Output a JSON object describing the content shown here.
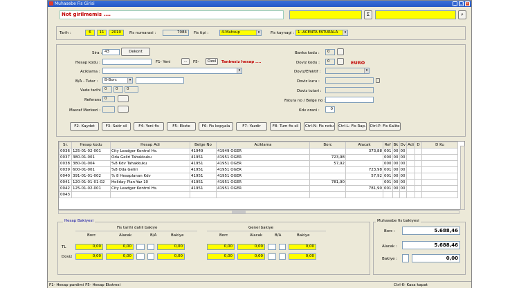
{
  "window": {
    "title": "Muhasebe Fis Girisi",
    "min": "_",
    "max": "□",
    "close": "×"
  },
  "top": {
    "warning": "Not girilmemis ....",
    "sigma": "Σ",
    "search": "⌕"
  },
  "header": {
    "tarih_label": "Tarih :",
    "day": "6",
    "month": "11",
    "year": "2010",
    "fis_no_label": "Fis numarasi :",
    "fis_no": "7084",
    "fis_tipi_label": "Fis tipi :",
    "fis_tipi": "4-Mahsup",
    "fis_kaynagi_label": "Fis kaynagi :",
    "fis_kaynagi": "1 -ACENTA FATURALA"
  },
  "form": {
    "sira_label": "Sira :",
    "sira": "43",
    "dekont": "Dekont",
    "hesap_kodu_label": "Hesap kodu :",
    "f1_yeni": "F1- Yeni",
    "dots": "...",
    "f5": "F5-",
    "ozel": "Ozel",
    "tanimsiz": "Tanimsiz hesap ....",
    "aciklama_label": "Aciklama :",
    "ba_tutar_label": "B/A - Tutar :",
    "ba": "B-Borc",
    "vade_label": "Vade tarihi :",
    "vade_d": "0",
    "vade_m": "0",
    "vade_y": "0",
    "referans_label": "Referans :",
    "referans": "0",
    "masraf_label": "Masraf Merkezi :",
    "banka_label": "Banka kodu :",
    "banka": "0",
    "doviz_kodu_label": "Doviz kodu :",
    "doviz_kodu": "0",
    "euro": "EURO",
    "doviz_efektif_label": "Doviz/Efektif :",
    "doviz_kuru_label": "Doviz kuru :",
    "doviz_tutari_label": "Doviz tutari :",
    "fatura_label": "Fatura no / Belge no :",
    "kdv_label": "Kdv orani :",
    "kdv": "0"
  },
  "buttons": [
    "F2- Kaydet",
    "F3- Satir sil",
    "F4- Yeni fis",
    "F5- Ekste",
    "F6- Fis kopyala",
    "F7- Yazdir",
    "F8- Tum fis sil",
    "Ctrl-N- Fis notu",
    "Ctrl-L- Fis Rap.",
    "Ctrl-P- Fis Kalite"
  ],
  "table": {
    "columns": [
      "Sr.",
      "Hesap kodu",
      "Hesap Adi",
      "Belge No",
      "Aciklama",
      "Borc",
      "Alacak",
      "Ref",
      "Bk",
      "Dv",
      "Adi",
      "D",
      "D Ku"
    ],
    "rows": [
      [
        "0036",
        "125-01-02-001",
        "City Leadger Kontrol Hs.",
        "41949",
        "41949 OGER",
        "",
        "373,88",
        "001",
        "00",
        "00",
        "",
        "",
        ""
      ],
      [
        "0037",
        "380-01-001",
        "Oda Geliri Tahakkuku",
        "41951",
        "41951 OGER",
        "723,98",
        "",
        "000",
        "00",
        "00",
        "",
        "",
        ""
      ],
      [
        "0038",
        "380-01-004",
        "%8 Kdv Tahakkuku",
        "41951",
        "41951 OGER",
        "57,92",
        "",
        "000",
        "00",
        "00",
        "",
        "",
        ""
      ],
      [
        "0039",
        "600-01-001",
        "%8 Oda Geliri",
        "41951",
        "41951 OGER",
        "",
        "723,98",
        "001",
        "00",
        "00",
        "",
        "",
        ""
      ],
      [
        "0040",
        "391-01-01-002",
        "% 8 Hesaplanan Kdv",
        "41951",
        "41951 OGER",
        "",
        "57,92",
        "001",
        "00",
        "00",
        "",
        "",
        ""
      ],
      [
        "0041",
        "120-01-01-01-02",
        "Holiday Plan-Yaz 10",
        "41951",
        "41951 OGER",
        "781,90",
        "",
        "001",
        "00",
        "00",
        "",
        "",
        ""
      ],
      [
        "0042",
        "125-01-02-001",
        "City Leadger Kontrol Hs.",
        "41951",
        "41951 OGER",
        "",
        "781,90",
        "001",
        "00",
        "00",
        "",
        "",
        ""
      ],
      [
        "0043",
        "",
        "",
        "",
        "",
        "",
        "",
        "",
        "",
        "",
        "",
        "",
        ""
      ]
    ]
  },
  "bakiye": {
    "title": "Hesap Bakiyesi",
    "fis_tarihi": "Fis tarihi dahil bakiye",
    "genel": "Genel bakiye",
    "borc": "Borc",
    "alacak": "Alacak",
    "ba": "B/A",
    "bakiye": "Bakiye",
    "tl": "TL",
    "doviz": "Doviz",
    "zero": "0,00"
  },
  "muhasebe": {
    "title": "Muhasebe fis bakiyesi",
    "borc_label": "Borc :",
    "borc": "5.688,46",
    "alacak_label": "Alacak :",
    "alacak": "5.688,46",
    "bakiye_label": "Bakiye :",
    "bakiye": "0,00"
  },
  "status": {
    "left": "F1- Hesap pardimi F5- Hesap Ekstresi",
    "right": "Ctrl-K- Kasa kapat"
  }
}
